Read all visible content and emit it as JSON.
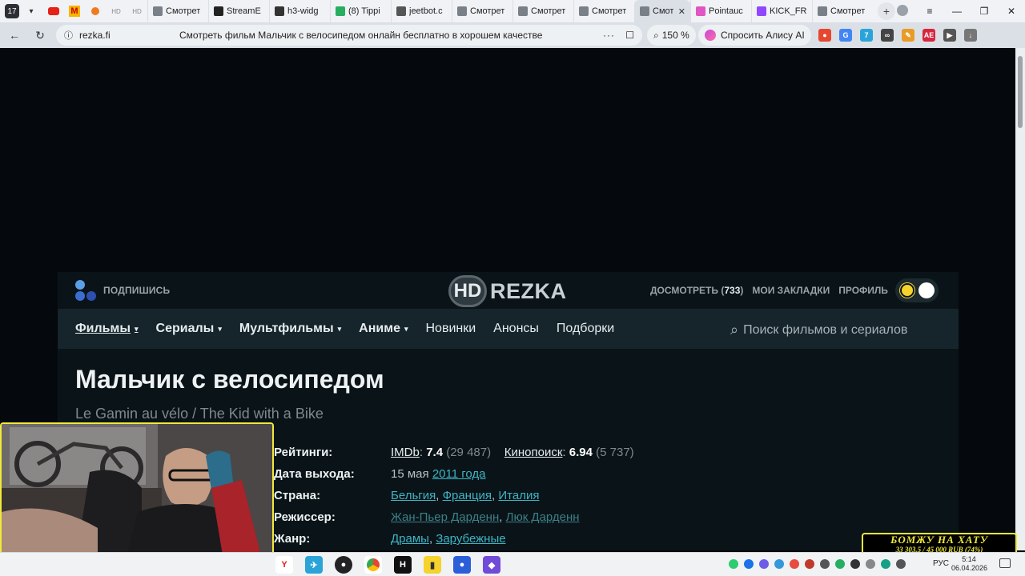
{
  "browser": {
    "tab_count": "17",
    "tabs": [
      {
        "title": "Смотрет",
        "color": "#7a8088"
      },
      {
        "title": "StreamE",
        "color": "#222222"
      },
      {
        "title": "h3-widg",
        "color": "#333333"
      },
      {
        "title": "(8) Tippi",
        "color": "#27ae60"
      },
      {
        "title": "jeetbot.c",
        "color": "#555555"
      },
      {
        "title": "Смотрет",
        "color": "#7a8088"
      },
      {
        "title": "Смотрет",
        "color": "#7a8088"
      },
      {
        "title": "Смотрет",
        "color": "#7a8088"
      },
      {
        "title": "Смотр",
        "color": "#7a8088",
        "active": true
      },
      {
        "title": "Pointauc",
        "color": "#e056c2"
      },
      {
        "title": "KICK_FR",
        "color": "#9146ff"
      },
      {
        "title": "Смотрет",
        "color": "#7a8088"
      }
    ],
    "url": "rezka.fi",
    "page_title": "Смотреть фильм Мальчик с велосипедом онлайн бесплатно в хорошем качестве",
    "zoom": "150 %",
    "alice_label": "Спросить Алису AI"
  },
  "site": {
    "subscribe_label": "ПОДПИШИСЬ",
    "logo_hd": "HD",
    "logo_text": "REZKA",
    "watch_later_label": "ДОСМОТРЕТЬ",
    "watch_later_count": "733",
    "bookmarks_label": "МОИ ЗАКЛАДКИ",
    "profile_label": "ПРОФИЛЬ",
    "menu": [
      {
        "label": "Фильмы",
        "dropdown": true
      },
      {
        "label": "Сериалы",
        "dropdown": true
      },
      {
        "label": "Мультфильмы",
        "dropdown": true
      },
      {
        "label": "Аниме",
        "dropdown": true
      },
      {
        "label": "Новинки",
        "dropdown": false
      },
      {
        "label": "Анонсы",
        "dropdown": false
      },
      {
        "label": "Подборки",
        "dropdown": false
      }
    ],
    "search_placeholder": "Поиск фильмов и сериалов"
  },
  "movie": {
    "title": "Мальчик с велосипедом",
    "original_title": "Le Gamin au vélo / The Kid with a Bike",
    "ratings_label": "Рейтинги:",
    "imdb_label": "IMDb",
    "imdb_score": "7.4",
    "imdb_votes": "(29 487)",
    "kp_label": "Кинопоиск",
    "kp_score": "6.94",
    "kp_votes": "(5 737)",
    "release_label": "Дата выхода:",
    "release_day": "15 мая",
    "release_year": "2011 года",
    "country_label": "Страна:",
    "countries": [
      "Бельгия",
      "Франция",
      "Италия"
    ],
    "director_label": "Режиссер:",
    "directors": [
      "Жан-Пьер Дарденн",
      "Люк Дарденн"
    ],
    "genre_label": "Жанр:",
    "genres": [
      "Драмы",
      "Зарубежные"
    ]
  },
  "overlay": {
    "donation_title": "БОМЖУ НА ХАТУ",
    "donation_amount": "33 303.5 / 45 000 RUB (74%)",
    "donation_progress": 0.74
  },
  "taskbar": {
    "lang": "РУС",
    "time": "5:14",
    "date": "06.04.2026"
  }
}
